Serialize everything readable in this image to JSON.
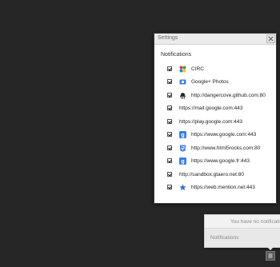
{
  "dialog": {
    "title": "Settings",
    "section_heading": "Notifications",
    "items": [
      {
        "label": "CIRC",
        "checked": true,
        "icon": "circ-app-icon"
      },
      {
        "label": "Google+ Photos",
        "checked": true,
        "icon": "google-photos-icon"
      },
      {
        "label": "http://dangercove.github.com:80",
        "checked": true,
        "icon": "octocat-icon"
      },
      {
        "label": "https://mail.google.com:443",
        "checked": true,
        "icon": ""
      },
      {
        "label": "https://play.google.com:443",
        "checked": true,
        "icon": ""
      },
      {
        "label": "https://www.google.com:443",
        "checked": true,
        "icon": "google-g-icon"
      },
      {
        "label": "http://www.html5rocks.com:80",
        "checked": true,
        "icon": "html5-icon"
      },
      {
        "label": "https://www.google.fr:443",
        "checked": true,
        "icon": "google-g-icon"
      },
      {
        "label": "http://sandbox.gtaero.net:80",
        "checked": true,
        "icon": ""
      },
      {
        "label": "https://web.mention.net:443",
        "checked": true,
        "icon": "star-icon"
      }
    ]
  },
  "notifications_panel": {
    "empty_text": "You have no notifications",
    "footer_label": "Notifications"
  },
  "colors": {
    "desktop": "#262626",
    "blue_icon": "#3b7de0",
    "star": "#2a6fd6"
  }
}
